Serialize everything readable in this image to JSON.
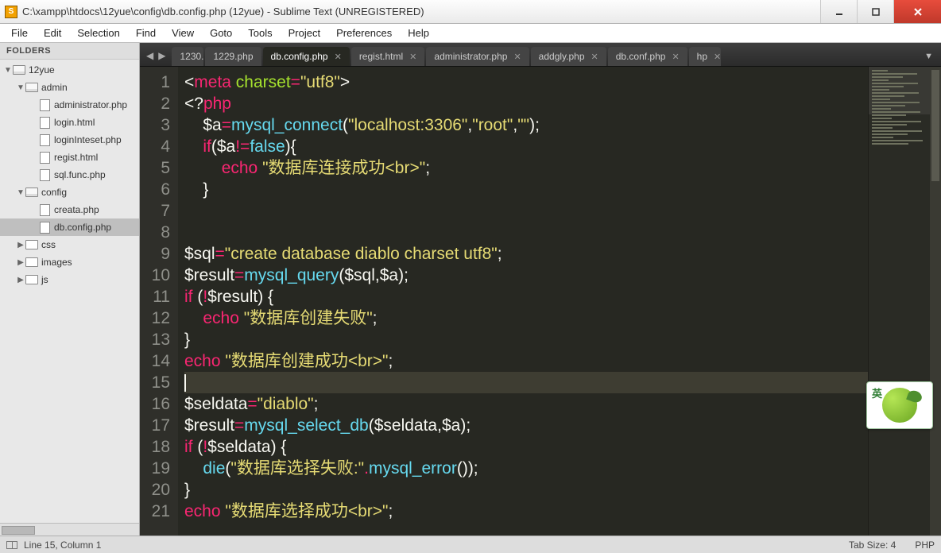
{
  "window": {
    "title": "C:\\xampp\\htdocs\\12yue\\config\\db.config.php (12yue) - Sublime Text (UNREGISTERED)"
  },
  "menu": [
    "File",
    "Edit",
    "Selection",
    "Find",
    "View",
    "Goto",
    "Tools",
    "Project",
    "Preferences",
    "Help"
  ],
  "sidebar": {
    "header": "FOLDERS",
    "tree": [
      {
        "depth": 0,
        "arrow": "▼",
        "icon": "folder-open",
        "label": "12yue",
        "selected": false
      },
      {
        "depth": 1,
        "arrow": "▼",
        "icon": "folder-open",
        "label": "admin",
        "selected": false
      },
      {
        "depth": 2,
        "arrow": "",
        "icon": "file",
        "label": "administrator.php",
        "selected": false
      },
      {
        "depth": 2,
        "arrow": "",
        "icon": "file",
        "label": "login.html",
        "selected": false
      },
      {
        "depth": 2,
        "arrow": "",
        "icon": "file",
        "label": "loginInteset.php",
        "selected": false
      },
      {
        "depth": 2,
        "arrow": "",
        "icon": "file",
        "label": "regist.html",
        "selected": false
      },
      {
        "depth": 2,
        "arrow": "",
        "icon": "file",
        "label": "sql.func.php",
        "selected": false
      },
      {
        "depth": 1,
        "arrow": "▼",
        "icon": "folder-open",
        "label": "config",
        "selected": false
      },
      {
        "depth": 2,
        "arrow": "",
        "icon": "file",
        "label": "creata.php",
        "selected": false
      },
      {
        "depth": 2,
        "arrow": "",
        "icon": "file",
        "label": "db.config.php",
        "selected": true
      },
      {
        "depth": 1,
        "arrow": "▶",
        "icon": "folder",
        "label": "css",
        "selected": false
      },
      {
        "depth": 1,
        "arrow": "▶",
        "icon": "folder",
        "label": "images",
        "selected": false
      },
      {
        "depth": 1,
        "arrow": "▶",
        "icon": "folder",
        "label": "js",
        "selected": false
      }
    ]
  },
  "tabs": [
    {
      "label": "1230.",
      "active": false,
      "close": false,
      "partial": true
    },
    {
      "label": "1229.php",
      "active": false,
      "close": false
    },
    {
      "label": "db.config.php",
      "active": true,
      "close": true
    },
    {
      "label": "regist.html",
      "active": false,
      "close": true
    },
    {
      "label": "administrator.php",
      "active": false,
      "close": true
    },
    {
      "label": "addgly.php",
      "active": false,
      "close": true
    },
    {
      "label": "db.conf.php",
      "active": false,
      "close": true
    },
    {
      "label": "hp",
      "active": false,
      "close": true,
      "partial": true
    }
  ],
  "code": {
    "lines": [
      {
        "n": 1,
        "tokens": [
          [
            "punct",
            "<"
          ],
          [
            "kw",
            "meta"
          ],
          [
            "punct",
            " "
          ],
          [
            "attr",
            "charset"
          ],
          [
            "op",
            "="
          ],
          [
            "str",
            "\"utf8\""
          ],
          [
            "punct",
            ">"
          ]
        ]
      },
      {
        "n": 2,
        "tokens": [
          [
            "punct",
            "<?"
          ],
          [
            "kw",
            "php"
          ]
        ]
      },
      {
        "n": 3,
        "tokens": [
          [
            "punct",
            "    "
          ],
          [
            "var",
            "$a"
          ],
          [
            "op",
            "="
          ],
          [
            "fn",
            "mysql_connect"
          ],
          [
            "punct",
            "("
          ],
          [
            "str",
            "\"localhost:3306\""
          ],
          [
            "punct",
            ","
          ],
          [
            "str",
            "\"root\""
          ],
          [
            "punct",
            ","
          ],
          [
            "str",
            "\"\""
          ],
          [
            "punct",
            ");"
          ]
        ]
      },
      {
        "n": 4,
        "tokens": [
          [
            "punct",
            "    "
          ],
          [
            "kw",
            "if"
          ],
          [
            "punct",
            "("
          ],
          [
            "var",
            "$a"
          ],
          [
            "op",
            "!="
          ],
          [
            "builtin",
            "false"
          ],
          [
            "punct",
            "){"
          ]
        ]
      },
      {
        "n": 5,
        "tokens": [
          [
            "punct",
            "        "
          ],
          [
            "kw",
            "echo"
          ],
          [
            "punct",
            " "
          ],
          [
            "str",
            "\"数据库连接成功<br>\""
          ],
          [
            "punct",
            ";"
          ]
        ]
      },
      {
        "n": 6,
        "tokens": [
          [
            "punct",
            "    }"
          ]
        ]
      },
      {
        "n": 7,
        "tokens": []
      },
      {
        "n": 8,
        "tokens": []
      },
      {
        "n": 9,
        "tokens": [
          [
            "var",
            "$sql"
          ],
          [
            "op",
            "="
          ],
          [
            "str",
            "\"create database diablo charset utf8\""
          ],
          [
            "punct",
            ";"
          ]
        ]
      },
      {
        "n": 10,
        "tokens": [
          [
            "var",
            "$result"
          ],
          [
            "op",
            "="
          ],
          [
            "fn",
            "mysql_query"
          ],
          [
            "punct",
            "("
          ],
          [
            "var",
            "$sql"
          ],
          [
            "punct",
            ","
          ],
          [
            "var",
            "$a"
          ],
          [
            "punct",
            ");"
          ]
        ]
      },
      {
        "n": 11,
        "tokens": [
          [
            "kw",
            "if"
          ],
          [
            "punct",
            " ("
          ],
          [
            "op",
            "!"
          ],
          [
            "var",
            "$result"
          ],
          [
            "punct",
            ") {"
          ]
        ]
      },
      {
        "n": 12,
        "tokens": [
          [
            "punct",
            "    "
          ],
          [
            "kw",
            "echo"
          ],
          [
            "punct",
            " "
          ],
          [
            "str",
            "\"数据库创建失败\""
          ],
          [
            "punct",
            ";"
          ]
        ]
      },
      {
        "n": 13,
        "tokens": [
          [
            "punct",
            "}"
          ]
        ]
      },
      {
        "n": 14,
        "tokens": [
          [
            "kw",
            "echo"
          ],
          [
            "punct",
            " "
          ],
          [
            "str",
            "\"数据库创建成功<br>\""
          ],
          [
            "punct",
            ";"
          ]
        ]
      },
      {
        "n": 15,
        "tokens": [],
        "current": true
      },
      {
        "n": 16,
        "tokens": [
          [
            "var",
            "$seldata"
          ],
          [
            "op",
            "="
          ],
          [
            "str",
            "\"diablo\""
          ],
          [
            "punct",
            ";"
          ]
        ]
      },
      {
        "n": 17,
        "tokens": [
          [
            "var",
            "$result"
          ],
          [
            "op",
            "="
          ],
          [
            "fn",
            "mysql_select_db"
          ],
          [
            "punct",
            "("
          ],
          [
            "var",
            "$seldata"
          ],
          [
            "punct",
            ","
          ],
          [
            "var",
            "$a"
          ],
          [
            "punct",
            ");"
          ]
        ]
      },
      {
        "n": 18,
        "tokens": [
          [
            "kw",
            "if"
          ],
          [
            "punct",
            " ("
          ],
          [
            "op",
            "!"
          ],
          [
            "var",
            "$seldata"
          ],
          [
            "punct",
            ") {"
          ]
        ]
      },
      {
        "n": 19,
        "tokens": [
          [
            "punct",
            "    "
          ],
          [
            "fn",
            "die"
          ],
          [
            "punct",
            "("
          ],
          [
            "str",
            "\"数据库选择失败:\""
          ],
          [
            "op",
            "."
          ],
          [
            "fn",
            "mysql_error"
          ],
          [
            "punct",
            "());"
          ]
        ]
      },
      {
        "n": 20,
        "tokens": [
          [
            "punct",
            "}"
          ]
        ]
      },
      {
        "n": 21,
        "tokens": [
          [
            "kw",
            "echo"
          ],
          [
            "punct",
            " "
          ],
          [
            "str",
            "\"数据库选择成功<br>\""
          ],
          [
            "punct",
            ";"
          ]
        ]
      }
    ]
  },
  "status": {
    "cursor": "Line 15, Column 1",
    "tabsize": "Tab Size: 4",
    "lang": "PHP"
  },
  "ime": {
    "char": "英"
  }
}
